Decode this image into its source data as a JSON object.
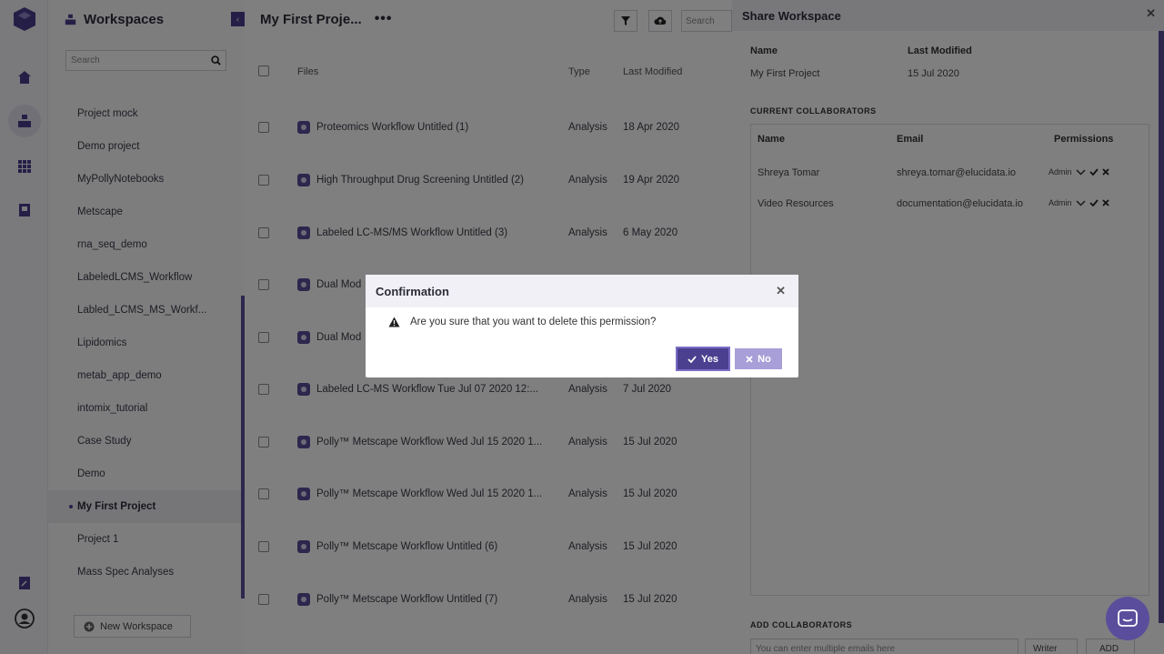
{
  "sidebar": {
    "title": "Workspaces",
    "search_placeholder": "Search",
    "items": [
      {
        "label": "Project mock"
      },
      {
        "label": "Demo project"
      },
      {
        "label": "MyPollyNotebooks"
      },
      {
        "label": "Metscape"
      },
      {
        "label": "rna_seq_demo"
      },
      {
        "label": "LabeledLCMS_Workflow"
      },
      {
        "label": "Labled_LCMS_MS_Workf..."
      },
      {
        "label": "Lipidomics"
      },
      {
        "label": "metab_app_demo"
      },
      {
        "label": "intomix_tutorial"
      },
      {
        "label": "Case Study"
      },
      {
        "label": "Demo"
      },
      {
        "label": "My First Project"
      },
      {
        "label": "Project 1"
      },
      {
        "label": "Mass Spec Analyses"
      }
    ],
    "active_item": "My First Project",
    "new_workspace_label": "New Workspace"
  },
  "main": {
    "title": "My First Proje...",
    "search_placeholder": "Search",
    "columns": {
      "files": "Files",
      "type": "Type",
      "last_modified": "Last Modified"
    },
    "rows": [
      {
        "name": "Proteomics Workflow Untitled (1)",
        "type": "Analysis",
        "modified": "18 Apr 2020"
      },
      {
        "name": "High Throughput Drug Screening Untitled (2)",
        "type": "Analysis",
        "modified": "19 Apr 2020"
      },
      {
        "name": "Labeled LC-MS/MS Workflow Untitled (3)",
        "type": "Analysis",
        "modified": "6 May 2020"
      },
      {
        "name": "Dual Mod",
        "type": "",
        "modified": ""
      },
      {
        "name": "Dual Mod",
        "type": "",
        "modified": ""
      },
      {
        "name": "Labeled LC-MS Workflow Tue Jul 07 2020 12:...",
        "type": "Analysis",
        "modified": "7 Jul 2020"
      },
      {
        "name": "Polly™ Metscape Workflow Wed Jul 15 2020 1...",
        "type": "Analysis",
        "modified": "15 Jul 2020"
      },
      {
        "name": "Polly™ Metscape Workflow Wed Jul 15 2020 1...",
        "type": "Analysis",
        "modified": "15 Jul 2020"
      },
      {
        "name": "Polly™ Metscape Workflow Untitled (6)",
        "type": "Analysis",
        "modified": "15 Jul 2020"
      },
      {
        "name": "Polly™ Metscape Workflow Untitled (7)",
        "type": "Analysis",
        "modified": "15 Jul 2020"
      }
    ]
  },
  "share": {
    "title": "Share Workspace",
    "name_label": "Name",
    "modified_label": "Last Modified",
    "name_value": "My First Project",
    "modified_value": "15 Jul 2020",
    "collaborators_title": "CURRENT COLLABORATORS",
    "col_name": "Name",
    "col_email": "Email",
    "col_permissions": "Permissions",
    "collaborators": [
      {
        "name": "Shreya Tomar",
        "email": "shreya.tomar@elucidata.io",
        "permission": "Admin"
      },
      {
        "name": "Video Resources",
        "email": "documentation@elucidata.io",
        "permission": "Admin"
      }
    ],
    "add_title": "ADD COLLABORATORS",
    "email_placeholder": "You can enter multiple emails here",
    "role_value": "Writer",
    "add_label": "ADD"
  },
  "dialog": {
    "title": "Confirmation",
    "message": "Are you sure that you want to delete this permission?",
    "yes_label": "Yes",
    "no_label": "No"
  },
  "colors": {
    "accent": "#4b3f8f",
    "accent_light": "#a89fd8",
    "overlay": "rgba(0,0,0,0.5)"
  }
}
